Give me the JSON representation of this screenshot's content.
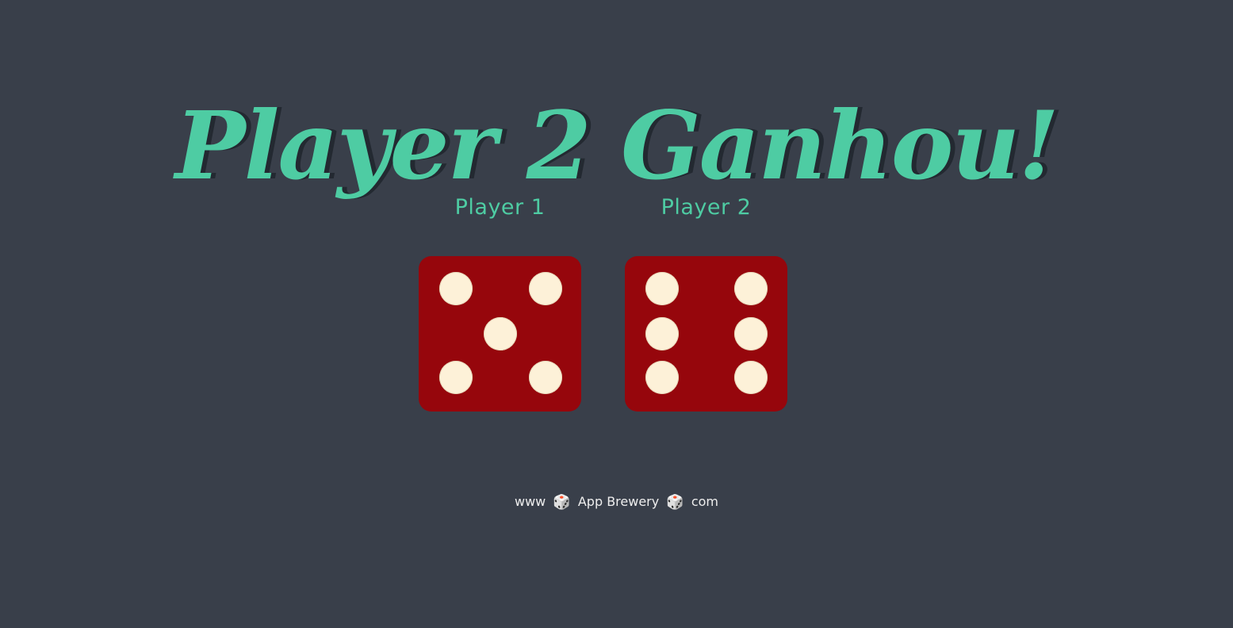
{
  "title": "Player 2 Ganhou!",
  "players": [
    {
      "label": "Player 1",
      "die_value": 5
    },
    {
      "label": "Player 2",
      "die_value": 6
    }
  ],
  "footer": {
    "part1": "www",
    "part2": "App Brewery",
    "part3": "com",
    "separator_icon": "dice-icon"
  },
  "colors": {
    "background": "#393f4a",
    "accent": "#4ecca3",
    "die": "#96060c",
    "pip": "#fdf1d8"
  }
}
